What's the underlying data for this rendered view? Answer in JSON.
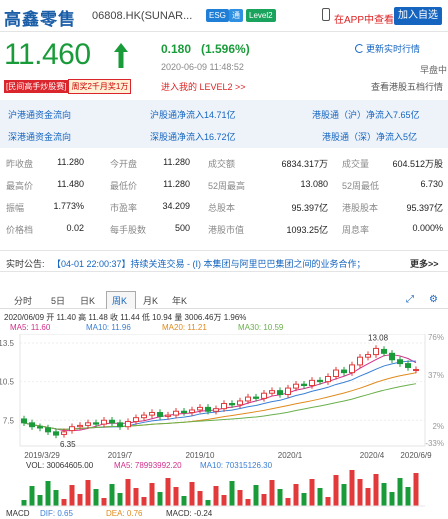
{
  "header": {
    "stock_name": "高鑫零售",
    "stock_code": "06808.HK(SUNAR...",
    "badges": [
      "ESG",
      "通",
      "Level2"
    ],
    "app_link": "在APP中查看",
    "watch_button": "加入自选"
  },
  "quote": {
    "price": "11.460",
    "change": "0.180",
    "change_pct": "(1.596%)",
    "time": "2020-06-09 11:48:52",
    "refresh": "更新实时行情",
    "session": "早盘中",
    "promo_left": "[民间高手炒股赛]",
    "promo_right": "周奖2千月奖1万",
    "level2_link": "进入我的 LEVEL2 >>",
    "five_level": "查看港股五档行情",
    "up_color": "#1a9b3a"
  },
  "flows": [
    [
      "沪港通资金流向",
      "沪股通净流入14.71亿",
      "港股通（沪）净流入7.65亿"
    ],
    [
      "深港通资金流向",
      "深股通净流入16.72亿",
      "港股通（深）净流入5亿"
    ]
  ],
  "stats": [
    [
      "昨收盘",
      "11.280",
      "今开盘",
      "11.280",
      "成交额",
      "6834.317万",
      "成交量",
      "604.512万股"
    ],
    [
      "最高价",
      "11.480",
      "最低价",
      "11.280",
      "52周最高",
      "13.080",
      "52周最低",
      "6.730"
    ],
    [
      "振幅",
      "1.773%",
      "市盈率",
      "34.209",
      "总股本",
      "95.397亿",
      "港股股本",
      "95.397亿"
    ],
    [
      "价格档",
      "0.02",
      "每手股数",
      "500",
      "港股市值",
      "1093.25亿",
      "周息率",
      "0.000%"
    ]
  ],
  "announcement": {
    "label": "实时公告:",
    "text": "【04-01 22:00:37】持续关连交易 - (I) 本集团与阿里巴巴集团之间的业务合作；",
    "more": "更多>>"
  },
  "chart_tabs": [
    "分时",
    "5日",
    "日K",
    "周K",
    "月K",
    "年K"
  ],
  "active_tab": "周K",
  "chart_info": {
    "line1": "2020/06/09 开 11.40 高 11.48 收 11.44 低 10.94 量 3006.46万 1.96%",
    "ma": [
      {
        "label": "MA5: 11.60",
        "color": "#d0308a"
      },
      {
        "label": "MA10: 11.96",
        "color": "#3a7fd5"
      },
      {
        "label": "MA20: 11.21",
        "color": "#e08a1c"
      },
      {
        "label": "MA30: 10.59",
        "color": "#6ab04c"
      }
    ]
  },
  "chart_data": {
    "type": "candlestick",
    "x_ticks": [
      "2019/3/29",
      "2019/7",
      "2019/10",
      "2020/1",
      "2020/4",
      "2020/6/9"
    ],
    "y_ticks": [
      "13.5",
      "10.5",
      "7.5"
    ],
    "right_ticks": [
      "76%",
      "37%",
      "2%",
      "-33%"
    ],
    "annotations": [
      "13.08",
      "6.35"
    ],
    "closes": [
      7.3,
      7.0,
      6.9,
      6.6,
      6.35,
      6.6,
      7.0,
      7.1,
      7.3,
      7.2,
      7.5,
      7.3,
      7.0,
      7.4,
      7.7,
      7.9,
      8.1,
      7.8,
      7.9,
      8.2,
      8.1,
      8.3,
      8.5,
      8.2,
      8.4,
      8.8,
      8.7,
      9.0,
      9.3,
      9.2,
      9.6,
      9.8,
      9.5,
      10.0,
      10.3,
      10.2,
      10.6,
      10.5,
      10.9,
      11.4,
      11.2,
      11.8,
      12.4,
      12.6,
      13.08,
      12.7,
      12.2,
      11.9,
      11.6,
      11.44
    ],
    "opens": [
      7.6,
      7.3,
      7.0,
      6.9,
      6.6,
      6.4,
      6.7,
      7.0,
      7.1,
      7.3,
      7.2,
      7.5,
      7.3,
      7.0,
      7.4,
      7.7,
      7.9,
      8.1,
      7.8,
      7.9,
      8.2,
      8.1,
      8.3,
      8.5,
      8.2,
      8.4,
      8.8,
      8.7,
      9.0,
      9.3,
      9.2,
      9.6,
      9.8,
      9.5,
      10.0,
      10.3,
      10.2,
      10.6,
      10.5,
      10.9,
      11.4,
      11.2,
      11.8,
      12.4,
      12.6,
      13.0,
      12.7,
      12.2,
      11.9,
      11.4
    ],
    "volume_info": {
      "label": "VOL: 30064605.00",
      "ma5": "MA5: 78993992.20",
      "ma10": "MA10: 70315126.30"
    },
    "macd_info": {
      "label": "MACD",
      "dif": "DIF: 0.65",
      "dea": "DEA: 0.76",
      "macd": "MACD: -0.24"
    }
  }
}
